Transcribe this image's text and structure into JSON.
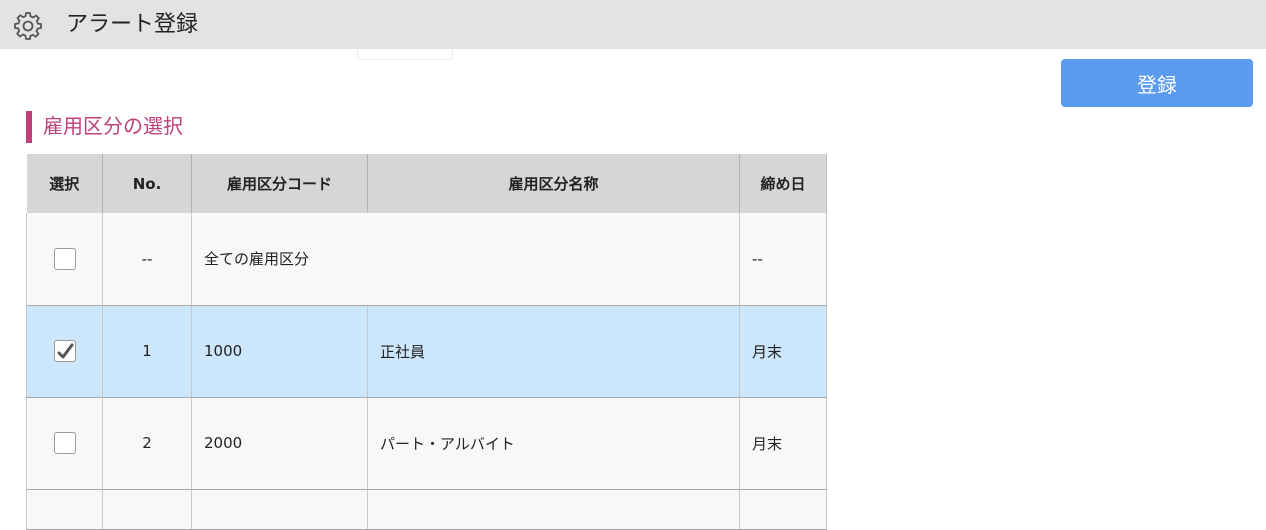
{
  "window": {
    "title": "アラート登録"
  },
  "toolbar": {
    "register_label": "登録"
  },
  "section": {
    "title": "雇用区分の選択"
  },
  "table": {
    "headers": [
      "選択",
      "No.",
      "雇用区分コード",
      "雇用区分名称",
      "締め日"
    ],
    "rows": [
      {
        "checked": false,
        "no": "--",
        "code": "全ての雇用区分",
        "name": "",
        "closing": "--"
      },
      {
        "checked": true,
        "no": "1",
        "code": "1000",
        "name": "正社員",
        "closing": "月末"
      },
      {
        "checked": false,
        "no": "2",
        "code": "2000",
        "name": "パート・アルバイト",
        "closing": "月末"
      }
    ]
  },
  "colors": {
    "accent": "#c0407a",
    "button": "#5b9bef",
    "selected_row": "#cce6fb",
    "header_bg": "#d5d6d7"
  },
  "icons": {
    "settings": "gear-icon",
    "check": "checkmark-icon"
  }
}
